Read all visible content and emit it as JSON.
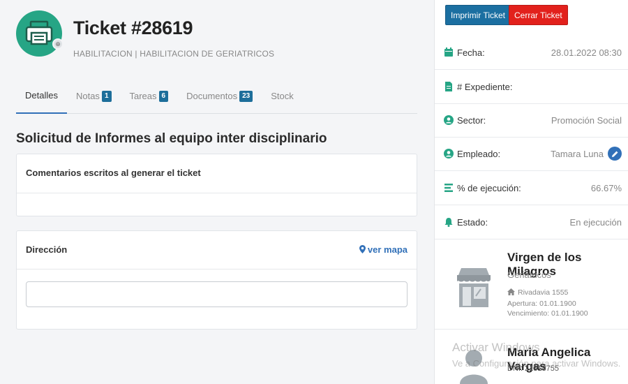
{
  "ticket": {
    "title": "Ticket #28619",
    "subtitle": "HABILITACION | HABILITACION DE GERIATRICOS"
  },
  "tabs": [
    {
      "label": "Detalles",
      "active": true
    },
    {
      "label": "Notas",
      "badge": "1"
    },
    {
      "label": "Tareas",
      "badge": "6"
    },
    {
      "label": "Documentos",
      "badge": "23"
    },
    {
      "label": "Stock"
    }
  ],
  "main": {
    "section_title": "Solicitud de Informes al equipo inter disciplinario",
    "comments_card_title": "Comentarios escritos al generar el ticket",
    "address_card_title": "Dirección",
    "map_link": "ver mapa",
    "address_value": ""
  },
  "actions": {
    "print_label": "Imprimir Ticket",
    "close_label": "Cerrar Ticket"
  },
  "info": {
    "fecha_label": "Fecha:",
    "fecha_value": "28.01.2022 08:30",
    "expediente_label": "# Expediente:",
    "expediente_value": "",
    "sector_label": "Sector:",
    "sector_value": "Promoción Social",
    "empleado_label": "Empleado:",
    "empleado_value": "Tamara Luna",
    "ejecucion_label": "% de ejecución:",
    "ejecucion_value": "66.67%",
    "estado_label": "Estado:",
    "estado_value": "En ejecución"
  },
  "establishment": {
    "name": "Virgen de los Milagros",
    "category": "Geriatricos",
    "address": "Rivadavia 1555",
    "apertura": "Apertura: 01.01.1900",
    "vencimiento": "Vencimiento: 01.01.1900"
  },
  "person": {
    "name": "Maria Angelica Vargas",
    "dni": "DNI: 21818755"
  },
  "watermark": {
    "line1": "Activar Windows",
    "line2": "Ve a Configuración para activar Windows."
  },
  "colors": {
    "accent": "#3170b8",
    "brand_green": "#26a585",
    "print_button": "#1b6fa1",
    "close_button": "#e2211c",
    "badge": "#1d6e9a"
  }
}
